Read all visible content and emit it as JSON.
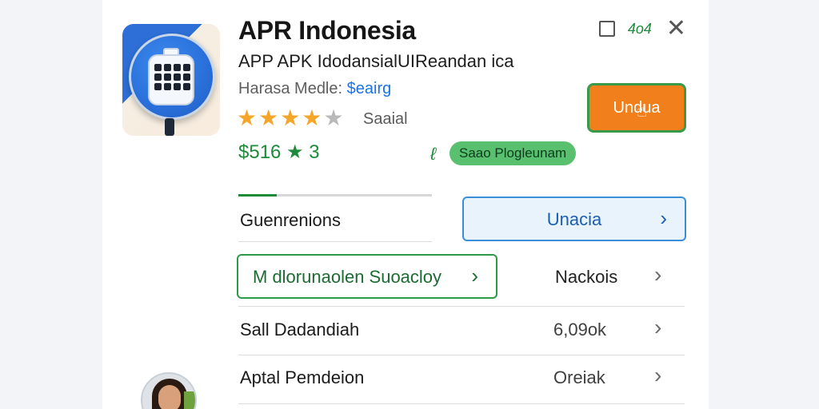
{
  "app": {
    "title": "APR Indonesia",
    "subtitle": "APP APK IdodansialUIReandan ica",
    "developer_label": "Harasa Medle:",
    "developer_link": "$eairg",
    "rating_stars": 4,
    "rating_max": 5,
    "rating_label": "Saaial",
    "price": "$516 ★ 3",
    "status_badge": "Saao Plogleunam",
    "install_label": "Undua"
  },
  "window": {
    "chip_text": "4o4"
  },
  "progress": {
    "fraction": 0.2
  },
  "rows": {
    "generations_label": "Guenrenions",
    "blue_button_label": "Unacia",
    "green_button_label": "M dlorunaolen Suoacloy",
    "green_row_value": "Nackois",
    "sale_label": "Sall Dadandiah",
    "sale_value": "6,09ok",
    "app_label": "Aptal Pemdeion",
    "app_value": "Oreiak"
  },
  "colors": {
    "install_button": "#f07f1c",
    "accent_green": "#1d8a3a",
    "accent_blue": "#1a73e8"
  },
  "icons": [
    "app-icon",
    "window-square-icon",
    "chip-icon",
    "close-icon",
    "star-icon",
    "cursor-icon",
    "status-icon",
    "chevron-right-icon",
    "avatar"
  ]
}
